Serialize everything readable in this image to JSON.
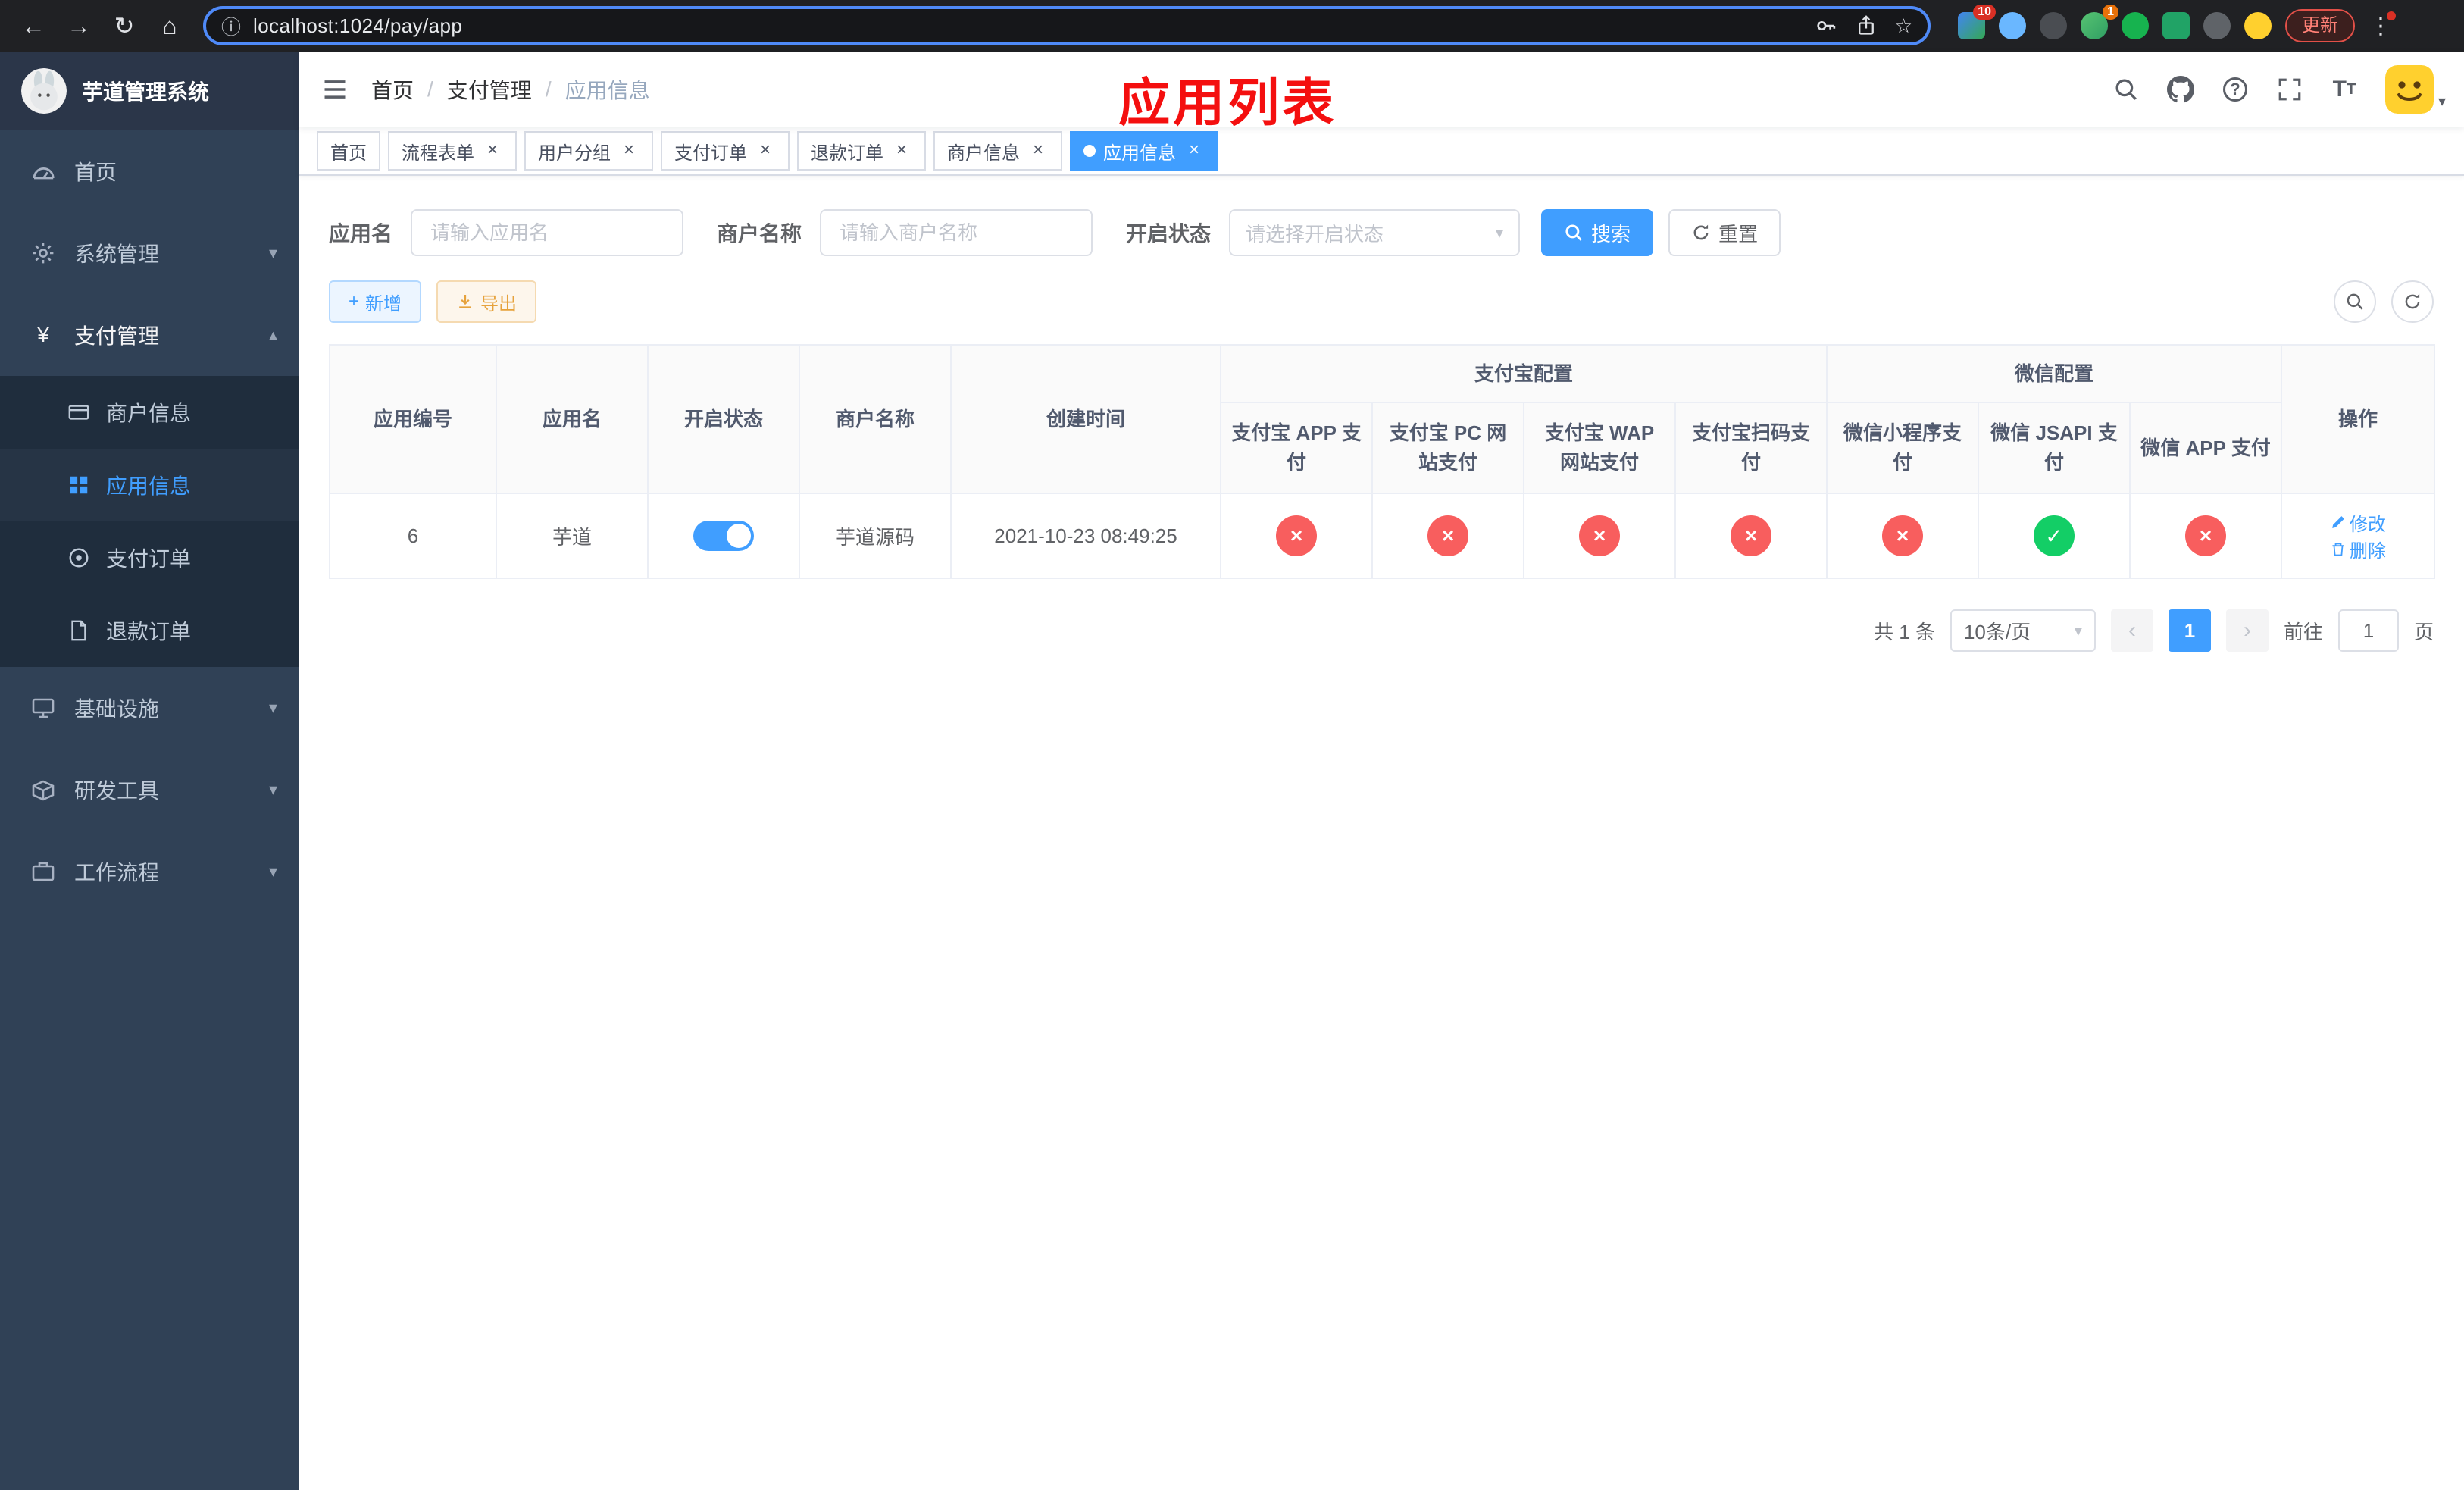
{
  "colors": {
    "accent": "#409eff",
    "danger": "#f85e5e",
    "success": "#13ce66",
    "warning": "#e6a23c",
    "sidebar_bg": "#304156",
    "submenu_bg": "#1f2d3d",
    "annotation_red": "#f40f0f"
  },
  "icons": {
    "back": "←",
    "forward": "→",
    "reload": "↻",
    "home": "⌂",
    "info": "ⓘ",
    "star": "☆",
    "kebab": "⋮",
    "close": "×",
    "caret_down": "▾",
    "caret_up": "▴",
    "prev": "‹",
    "next": "›",
    "plus": "+",
    "question": "?",
    "yen": "¥",
    "check": "✓",
    "cross": "×",
    "breadcrumb_sep": "/"
  },
  "browser": {
    "url": "localhost:1024/pay/app",
    "update_label": "更新",
    "ext_badge_puzzle": "10",
    "ext_badge_orange": "1"
  },
  "sidebar": {
    "title": "芋道管理系统",
    "items": [
      {
        "label": "首页"
      },
      {
        "label": "系统管理"
      },
      {
        "label": "支付管理"
      },
      {
        "label": "基础设施"
      },
      {
        "label": "研发工具"
      },
      {
        "label": "工作流程"
      }
    ],
    "payment_children": [
      {
        "label": "商户信息"
      },
      {
        "label": "应用信息"
      },
      {
        "label": "支付订单"
      },
      {
        "label": "退款订单"
      }
    ]
  },
  "header": {
    "breadcrumb": [
      "首页",
      "支付管理",
      "应用信息"
    ],
    "annotation": "应用列表"
  },
  "tabs": [
    {
      "label": "首页"
    },
    {
      "label": "流程表单"
    },
    {
      "label": "用户分组"
    },
    {
      "label": "支付订单"
    },
    {
      "label": "退款订单"
    },
    {
      "label": "商户信息"
    },
    {
      "label": "应用信息"
    }
  ],
  "filters": {
    "app_name": {
      "label": "应用名",
      "placeholder": "请输入应用名",
      "value": ""
    },
    "merchant_name": {
      "label": "商户名称",
      "placeholder": "请输入商户名称",
      "value": ""
    },
    "status": {
      "label": "开启状态",
      "placeholder": "请选择开启状态",
      "value": ""
    },
    "search_label": "搜索",
    "reset_label": "重置"
  },
  "toolbar": {
    "add_label": "新增",
    "export_label": "导出"
  },
  "table": {
    "groups": {
      "alipay": "支付宝配置",
      "wechat": "微信配置"
    },
    "columns": {
      "id": "应用编号",
      "name": "应用名",
      "status": "开启状态",
      "merchant": "商户名称",
      "created": "创建时间",
      "ops": "操作"
    },
    "alipay_columns": [
      "支付宝 APP 支付",
      "支付宝 PC 网站支付",
      "支付宝 WAP 网站支付",
      "支付宝扫码支付"
    ],
    "wechat_columns": [
      "微信小程序支付",
      "微信 JSAPI 支付",
      "微信 APP 支付"
    ],
    "row": {
      "id": "6",
      "name": "芋道",
      "status_on": true,
      "merchant": "芋道源码",
      "created": "2021-10-23 08:49:25",
      "configs": [
        false,
        false,
        false,
        false,
        false,
        true,
        false
      ]
    },
    "ops": {
      "edit": "修改",
      "delete": "删除"
    }
  },
  "pagination": {
    "total": "共 1 条",
    "page_size": "10条/页",
    "page": "1",
    "goto_label": "前往",
    "goto_value": "1",
    "unit_label": "页"
  }
}
